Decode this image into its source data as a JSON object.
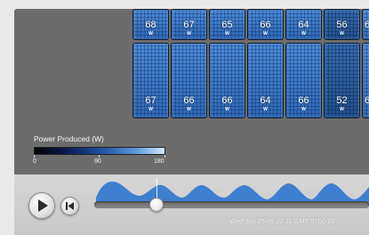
{
  "panels": {
    "top_row": [
      {
        "value": "68",
        "unit": "W"
      },
      {
        "value": "67",
        "unit": "W"
      },
      {
        "value": "65",
        "unit": "W"
      },
      {
        "value": "66",
        "unit": "W"
      },
      {
        "value": "64",
        "unit": "W"
      },
      {
        "value": "56",
        "unit": "W"
      },
      {
        "value": "6",
        "unit": "W"
      }
    ],
    "bottom_row": [
      {
        "value": "67",
        "unit": "W"
      },
      {
        "value": "66",
        "unit": "W"
      },
      {
        "value": "66",
        "unit": "W"
      },
      {
        "value": "64",
        "unit": "W"
      },
      {
        "value": "66",
        "unit": "W"
      },
      {
        "value": "52",
        "unit": "W"
      },
      {
        "value": "6",
        "unit": "W"
      }
    ]
  },
  "legend": {
    "title": "Power Produced (W)",
    "min": "0",
    "mid": "90",
    "max": "180"
  },
  "playback": {
    "play_icon": "play-icon",
    "rewind_icon": "skip-to-start-icon",
    "timestamp": "Wed Jun 25 09:22:11 GMT-0700 20",
    "position": 0.23
  },
  "colors": {
    "viewport_bg": "#6c6c6c",
    "panel_blue": "#3b77c4",
    "sparkline_blue": "#3f7fcf",
    "controls_bg": "#d0d0d0"
  }
}
